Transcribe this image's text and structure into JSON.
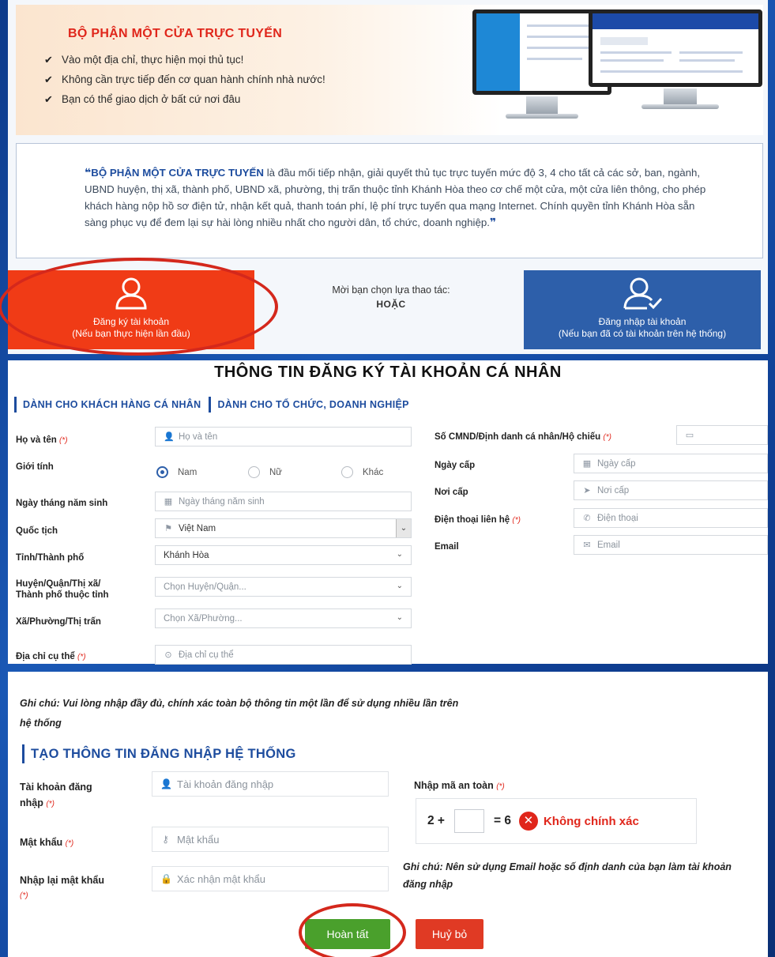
{
  "banner": {
    "title": "BỘ PHẬN MỘT CỬA TRỰC TUYẾN",
    "bullets": [
      "Vào một địa chỉ, thực hiện mọi thủ tục!",
      "Không cần trực tiếp đến cơ quan hành chính nhà nước!",
      "Bạn có thể giao dịch ở bất cứ nơi đâu"
    ]
  },
  "intro": {
    "highlight": "BỘ PHẬN MỘT CỬA TRỰC TUYẾN",
    "text": " là đầu mối tiếp nhận, giải quyết thủ tục trực tuyến mức độ 3, 4 cho tất cả các sở, ban, ngành, UBND huyện, thị xã, thành phố, UBND xã, phường, thị trấn thuộc tỉnh Khánh Hòa theo cơ chế một cửa, một cửa liên thông, cho phép khách hàng nộp hồ sơ điện tử, nhận kết quả, thanh toán phí, lệ phí trực tuyến qua mạng Internet. Chính quyền tỉnh Khánh Hòa sẵn sàng phục vụ để đem lại sự hài lòng nhiều nhất cho người dân, tổ chức, doanh nghiệp."
  },
  "actions": {
    "register_line1": "Đăng ký tài khoản",
    "register_line2": "(Nếu bạn thực hiện lần đầu)",
    "choose_prompt": "Mời bạn chọn lựa thao tác:",
    "or": "HOẶC",
    "login_line1": "Đăng nhập tài khoản",
    "login_line2": "(Nếu bạn đã có tài khoản trên hệ thống)"
  },
  "form": {
    "title": "THÔNG TIN ĐĂNG KÝ TÀI KHOẢN CÁ NHÂN",
    "tab_individual": "DÀNH CHO KHÁCH HÀNG CÁ NHÂN",
    "tab_org": "DÀNH CHO TỔ CHỨC, DOANH NGHIỆP",
    "required_mark": "(*)",
    "fullname_label": "Họ và tên",
    "fullname_placeholder": "Họ và tên",
    "gender_label": "Giới tính",
    "gender_male": "Nam",
    "gender_female": "Nữ",
    "gender_other": "Khác",
    "dob_label": "Ngày tháng năm sinh",
    "dob_placeholder": "Ngày tháng năm sinh",
    "nationality_label": "Quốc tịch",
    "nationality_value": "Việt Nam",
    "province_label": "Tỉnh/Thành phố",
    "province_value": "Khánh Hòa",
    "district_label_1": "Huyện/Quận/Thị xã/",
    "district_label_2": "Thành phố thuộc tỉnh",
    "district_placeholder": "Chọn Huyện/Quận...",
    "ward_label": "Xã/Phường/Thị trấn",
    "ward_placeholder": "Chọn Xã/Phường...",
    "address_label": "Địa chỉ cụ thể",
    "address_placeholder": "Địa chỉ cụ thể",
    "id_label": "Số CMND/Định danh cá nhân/Hộ chiếu",
    "issue_date_label": "Ngày cấp",
    "issue_date_placeholder": "Ngày cấp",
    "issue_place_label": "Nơi cấp",
    "issue_place_placeholder": "Nơi cấp",
    "phone_label": "Điện thoại liên hệ",
    "phone_placeholder": "Điện thoại",
    "email_label": "Email",
    "email_placeholder": "Email"
  },
  "login": {
    "note_line1": "Ghi chú: Vui lòng nhập đầy đủ, chính xác toàn bộ thông tin một lần để sử dụng nhiều lần trên",
    "note_line2": "hệ thống",
    "section_title": "TẠO THÔNG TIN ĐĂNG NHẬP HỆ THỐNG",
    "account_label_1": "Tài khoản đăng",
    "account_label_2": "nhập",
    "account_placeholder": "Tài khoản đăng nhập",
    "password_label": "Mật khẩu",
    "password_placeholder": "Mật khẩu",
    "confirm_label": "Nhập lại mật khẩu",
    "confirm_placeholder": "Xác nhận mật khẩu",
    "captcha_label": "Nhập mã an toàn",
    "captcha_left": "2 +",
    "captcha_right": "= 6",
    "captcha_error": "Không chính xác",
    "note2_line1": "Ghi chú: Nên sử dụng Email hoặc số định danh của bạn làm tài khoản",
    "note2_line2": "đăng nhập",
    "done_button": "Hoàn tất",
    "cancel_button": "Huỷ bỏ"
  },
  "colors": {
    "accent_blue": "#1d4c9e",
    "register_red": "#f03b16",
    "login_blue": "#2d5faa",
    "done_green": "#4aa02c",
    "cancel_red": "#e03a24"
  }
}
